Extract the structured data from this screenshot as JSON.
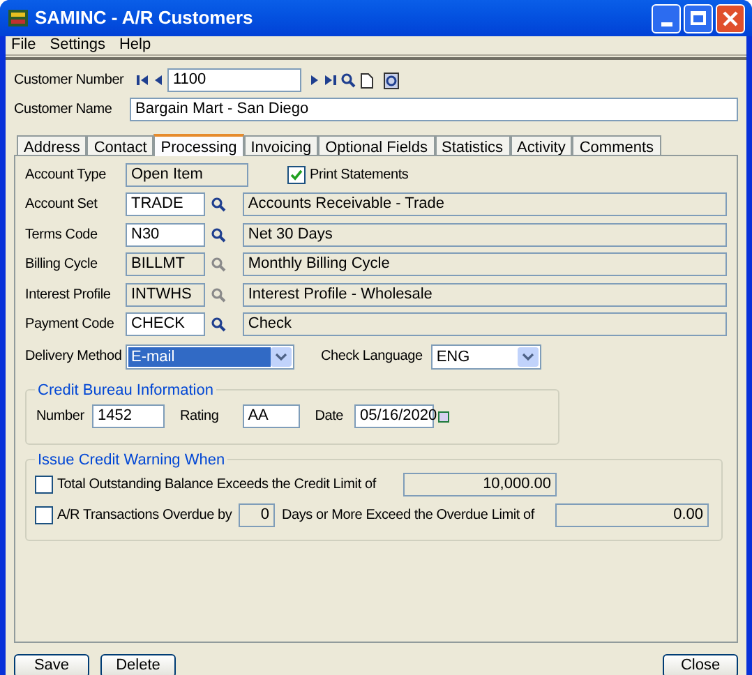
{
  "window": {
    "title": "SAMINC - A/R Customers"
  },
  "menu": [
    "File",
    "Settings",
    "Help"
  ],
  "customer_number": {
    "label": "Customer Number",
    "value": "1100"
  },
  "customer_name": {
    "label": "Customer Name",
    "value": "Bargain Mart - San Diego"
  },
  "tabs": [
    {
      "label": "Address",
      "selected": false
    },
    {
      "label": "Contact",
      "selected": false
    },
    {
      "label": "Processing",
      "selected": true
    },
    {
      "label": "Invoicing",
      "selected": false
    },
    {
      "label": "Optional Fields",
      "selected": false
    },
    {
      "label": "Statistics",
      "selected": false
    },
    {
      "label": "Activity",
      "selected": false
    },
    {
      "label": "Comments",
      "selected": false
    }
  ],
  "account_type": {
    "label": "Account Type",
    "value": "Open Item"
  },
  "print_statements": {
    "label": "Print Statements",
    "checked": true
  },
  "code_rows": [
    {
      "label": "Account Set",
      "code": "TRADE",
      "description": "Accounts Receivable - Trade",
      "disabled": false
    },
    {
      "label": "Terms Code",
      "code": "N30",
      "description": "Net 30 Days",
      "disabled": false
    },
    {
      "label": "Billing Cycle",
      "code": "BILLMT",
      "description": "Monthly Billing Cycle",
      "disabled": true
    },
    {
      "label": "Interest Profile",
      "code": "INTWHS",
      "description": "Interest Profile - Wholesale",
      "disabled": true
    },
    {
      "label": "Payment Code",
      "code": "CHECK",
      "description": "Check",
      "disabled": false
    }
  ],
  "delivery_method": {
    "label": "Delivery Method",
    "value": "E-mail",
    "selected": true
  },
  "check_language": {
    "label": "Check Language",
    "value": "ENG",
    "selected": false
  },
  "credit_bureau": {
    "title": "Credit Bureau Information",
    "number_label": "Number",
    "number": "1452",
    "rating_label": "Rating",
    "rating": "AA",
    "date_label": "Date",
    "date": "05/16/2020"
  },
  "credit_warning": {
    "title": "Issue Credit Warning When",
    "balance": {
      "label": "Total Outstanding Balance Exceeds the Credit Limit of",
      "checked": false,
      "amount": "10,000.00"
    },
    "overdue": {
      "label": "A/R Transactions Overdue by",
      "checked": false,
      "days": "0",
      "suffix": "Days or More Exceed the Overdue Limit of",
      "amount": "0.00"
    }
  },
  "buttons": [
    "Save",
    "Delete",
    "Close"
  ]
}
